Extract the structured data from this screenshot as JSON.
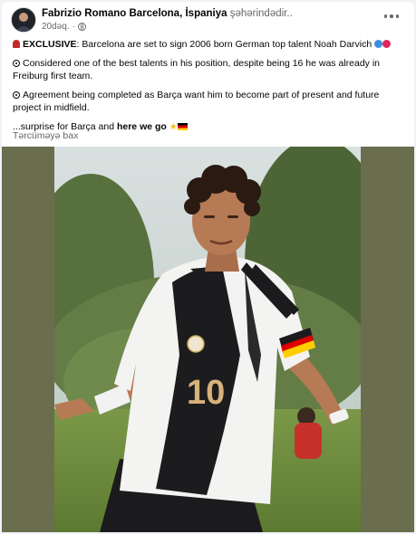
{
  "post": {
    "author": "Fabrizio Romano Barcelona",
    "place": "İspaniya",
    "place_suffix": "şəhərindədir..",
    "time": "20dəq.",
    "more_label": "More options",
    "lines": {
      "l1_bold": "EXCLUSIVE",
      "l1_text": ": Barcelona are set to sign 2006 born German top talent Noah Darvich",
      "l2": "Considered one of the best talents in his position, despite being 16 he was already in Freiburg first team.",
      "l3": "Agreement being completed as Barça want him to become part of present and future project in midfield.",
      "l4_text": "...surprise for Barça and ",
      "l4_bold": "here we go"
    },
    "translate": "Tərcüməyə bax"
  },
  "photo": {
    "shirt_number": "10",
    "colors": {
      "background_sky": "#cfd8d6",
      "trees": "#4f6a3a",
      "grass": "#6f8f3e",
      "shirt_white": "#f3f3f1",
      "shirt_black": "#1b1b1d",
      "skin": "#b67a55",
      "hair": "#2a1a12"
    }
  }
}
